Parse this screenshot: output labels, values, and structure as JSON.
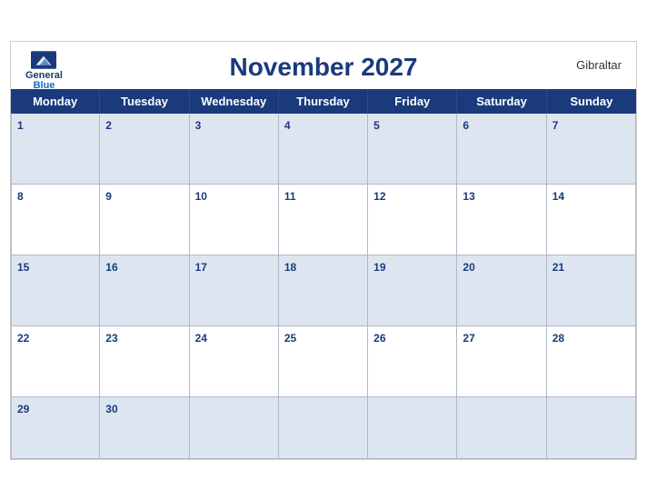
{
  "header": {
    "title": "November 2027",
    "location": "Gibraltar",
    "logo_general": "General",
    "logo_blue": "Blue"
  },
  "days_of_week": [
    "Monday",
    "Tuesday",
    "Wednesday",
    "Thursday",
    "Friday",
    "Saturday",
    "Sunday"
  ],
  "weeks": [
    [
      {
        "num": "1",
        "empty": false
      },
      {
        "num": "2",
        "empty": false
      },
      {
        "num": "3",
        "empty": false
      },
      {
        "num": "4",
        "empty": false
      },
      {
        "num": "5",
        "empty": false
      },
      {
        "num": "6",
        "empty": false
      },
      {
        "num": "7",
        "empty": false
      }
    ],
    [
      {
        "num": "8",
        "empty": false
      },
      {
        "num": "9",
        "empty": false
      },
      {
        "num": "10",
        "empty": false
      },
      {
        "num": "11",
        "empty": false
      },
      {
        "num": "12",
        "empty": false
      },
      {
        "num": "13",
        "empty": false
      },
      {
        "num": "14",
        "empty": false
      }
    ],
    [
      {
        "num": "15",
        "empty": false
      },
      {
        "num": "16",
        "empty": false
      },
      {
        "num": "17",
        "empty": false
      },
      {
        "num": "18",
        "empty": false
      },
      {
        "num": "19",
        "empty": false
      },
      {
        "num": "20",
        "empty": false
      },
      {
        "num": "21",
        "empty": false
      }
    ],
    [
      {
        "num": "22",
        "empty": false
      },
      {
        "num": "23",
        "empty": false
      },
      {
        "num": "24",
        "empty": false
      },
      {
        "num": "25",
        "empty": false
      },
      {
        "num": "26",
        "empty": false
      },
      {
        "num": "27",
        "empty": false
      },
      {
        "num": "28",
        "empty": false
      }
    ],
    [
      {
        "num": "29",
        "empty": false
      },
      {
        "num": "30",
        "empty": false
      },
      {
        "num": "",
        "empty": true
      },
      {
        "num": "",
        "empty": true
      },
      {
        "num": "",
        "empty": true
      },
      {
        "num": "",
        "empty": true
      },
      {
        "num": "",
        "empty": true
      }
    ]
  ]
}
